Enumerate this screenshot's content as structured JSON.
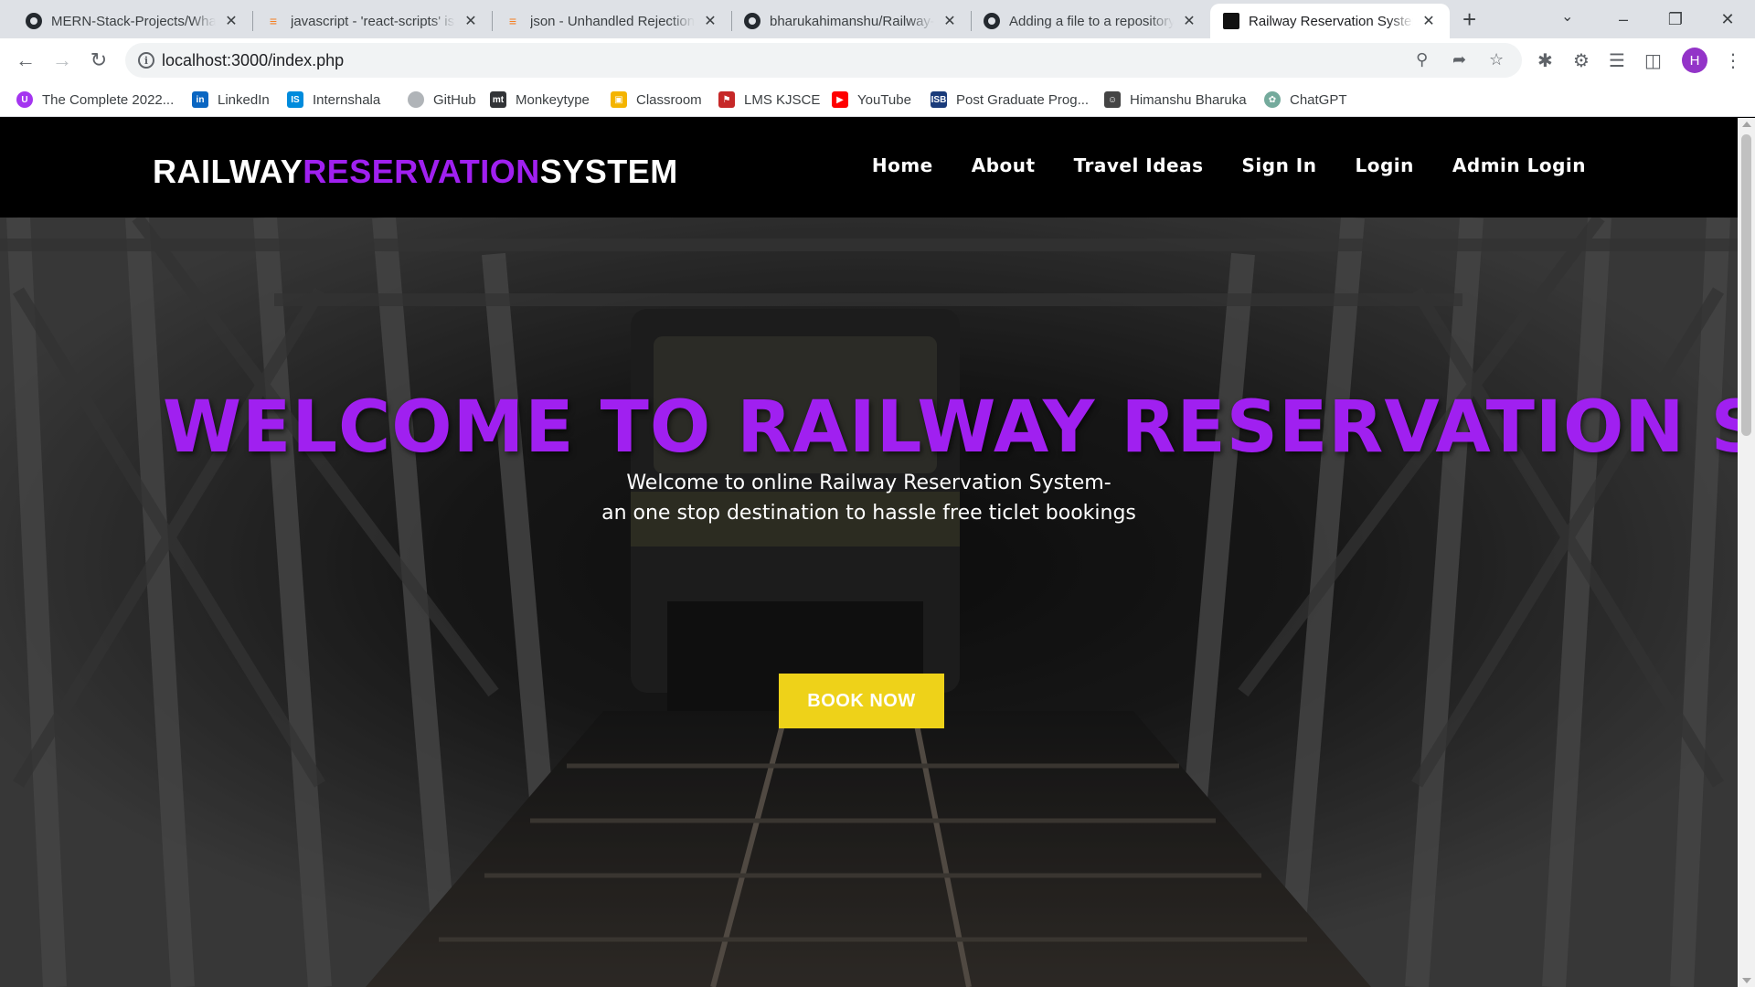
{
  "browser": {
    "tabs": [
      {
        "title": "MERN-Stack-Projects/What",
        "favicon": "github-icon",
        "active": false
      },
      {
        "title": "javascript - 'react-scripts' is",
        "favicon": "stackoverflow-icon",
        "active": false
      },
      {
        "title": "json - Unhandled Rejection",
        "favicon": "stackoverflow-icon",
        "active": false
      },
      {
        "title": "bharukahimanshu/Railway-",
        "favicon": "github-icon",
        "active": false
      },
      {
        "title": "Adding a file to a repository",
        "favicon": "github-icon",
        "active": false
      },
      {
        "title": "Railway Reservation System",
        "favicon": "site-icon",
        "active": true
      }
    ],
    "address_url": "localhost:3000/index.php",
    "profile_initial": "H",
    "profile_color": "#9334c8",
    "bookmarks": [
      {
        "label": "The Complete 2022...",
        "icon": "udemy-icon",
        "color": "#a435f0"
      },
      {
        "label": "LinkedIn",
        "icon": "linkedin-icon",
        "color": "#0a66c2"
      },
      {
        "label": "Internshala",
        "icon": "internshala-icon",
        "color": "#008bdc"
      },
      {
        "label": "GitHub",
        "icon": "github-icon",
        "color": "#b0b4b8"
      },
      {
        "label": "Monkeytype",
        "icon": "monkeytype-icon",
        "color": "#323437"
      },
      {
        "label": "Classroom",
        "icon": "classroom-icon",
        "color": "#f4b400"
      },
      {
        "label": "LMS KJSCE",
        "icon": "lms-icon",
        "color": "#c62828"
      },
      {
        "label": "YouTube",
        "icon": "youtube-icon",
        "color": "#ff0000"
      },
      {
        "label": "Post Graduate Prog...",
        "icon": "isb-icon",
        "color": "#1a3b7a"
      },
      {
        "label": "Himanshu Bharuka",
        "icon": "person-icon",
        "color": "#444444"
      },
      {
        "label": "ChatGPT",
        "icon": "chatgpt-icon",
        "color": "#74aa9c"
      }
    ]
  },
  "site": {
    "brand": {
      "part1": "RAILWAY",
      "part2": "RESERVATION",
      "part3": "SYSTEM"
    },
    "menu": [
      "Home",
      "About",
      "Travel Ideas",
      "Sign In",
      "Login",
      "Admin Login"
    ],
    "hero": {
      "title": "WELCOME TO RAILWAY RESERVATION SY",
      "subtitle_line1": "Welcome to online Railway Reservation System-",
      "subtitle_line2": "an one stop destination to hassle free ticlet bookings",
      "cta": "BOOK NOW"
    },
    "colors": {
      "accent": "#a020f0",
      "cta": "#eed219",
      "nav_bg": "#000000"
    }
  }
}
